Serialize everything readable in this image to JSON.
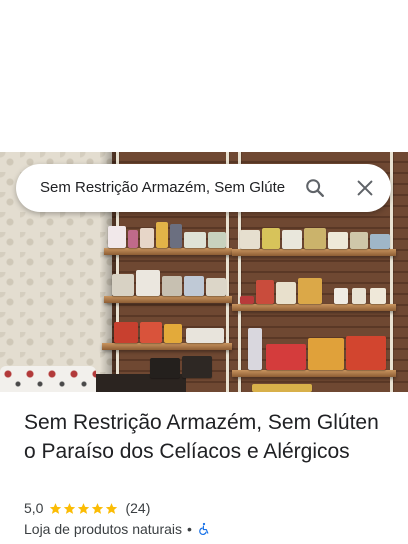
{
  "search": {
    "query": "Sem Restrição Armazém, Sem Glúte"
  },
  "place": {
    "name": "Sem Restrição Armazém, Sem Glúten o Paraíso dos Celíacos e Alérgicos",
    "rating": "5,0",
    "stars": 5,
    "reviews": "(24)",
    "category": "Loja de produtos naturais",
    "separator": "•"
  },
  "icons": {
    "search": "search-icon",
    "close": "close-icon",
    "star": "star-icon",
    "wheelchair": "wheelchair-accessible-icon"
  },
  "colors": {
    "star": "#fbbc04",
    "accessibility": "#1a73e8",
    "icon": "#5f6368",
    "text": "#202124"
  }
}
